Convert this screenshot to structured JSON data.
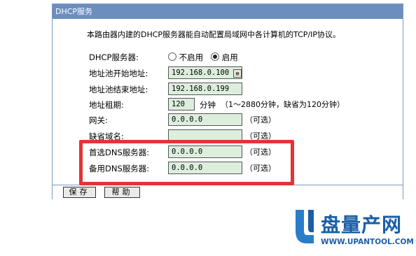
{
  "panel": {
    "title": "DHCP服务",
    "intro": "本路由器内建的DHCP服务器能自动配置局域网中各计算机的TCP/IP协议。"
  },
  "form": {
    "dhcp_server": {
      "label": "DHCP服务器:",
      "options": [
        "不启用",
        "启用"
      ],
      "selected": "启用"
    },
    "pool_start": {
      "label": "地址池开始地址:",
      "value": "192.168.0.100"
    },
    "pool_end": {
      "label": "地址池结束地址:",
      "value": "192.168.0.199"
    },
    "lease": {
      "label": "地址租期:",
      "value": "120",
      "unit": "分钟",
      "hint": "（1～2880分钟，缺省为120分钟）"
    },
    "gateway": {
      "label": "网关:",
      "value": "0.0.0.0",
      "optional": "（可选）"
    },
    "domain": {
      "label": "缺省域名:",
      "value": "",
      "optional": "（可选）"
    },
    "dns_primary": {
      "label": "首选DNS服务器:",
      "value": "0.0.0.0",
      "optional": "（可选）"
    },
    "dns_secondary": {
      "label": "备用DNS服务器:",
      "value": "0.0.0.0",
      "optional": "（可选）"
    }
  },
  "buttons": {
    "save": "保存",
    "help": "帮助"
  },
  "watermark": {
    "brand": "盘量产网",
    "url": "WWW.UPANTOOL.COM"
  },
  "colors": {
    "header": "#6b8ebd",
    "input_bg": "#ddeedd",
    "highlight": "#e53333"
  }
}
